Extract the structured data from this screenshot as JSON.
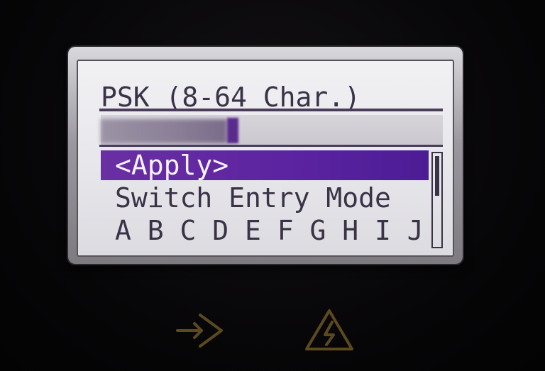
{
  "display": {
    "title": "PSK (8-64 Char.)",
    "menu": [
      {
        "label": "<Apply>",
        "selected": true
      },
      {
        "label": "Switch Entry Mode",
        "selected": false
      },
      {
        "label": "A B C D E F G H I J",
        "selected": false
      }
    ]
  },
  "buttons": {
    "enter_icon": "enter-arrow-icon",
    "warning_icon": "electrical-warning-icon"
  },
  "colors": {
    "selection": "#5b23a0",
    "lcd_text": "#3a3246",
    "lcd_background": "#eceaef",
    "icon": "#5c4a1e"
  }
}
